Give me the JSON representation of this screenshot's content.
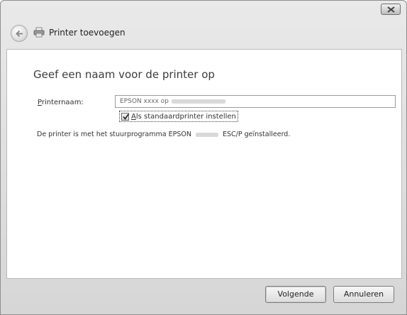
{
  "window": {
    "title": "Printer toevoegen"
  },
  "page": {
    "heading": "Geef een naam voor de printer op",
    "printer_name_label": "Printernaam:",
    "printer_name_value_prefix": "EPSON xxxx op",
    "default_checkbox_label": "Als standaardprinter instellen",
    "default_checkbox_checked": true,
    "info_prefix": "De printer is met het stuurprogramma EPSON",
    "info_suffix": "ESC/P geïnstalleerd."
  },
  "footer": {
    "next_label": "Volgende",
    "cancel_label": "Annuleren"
  },
  "icons": {
    "close": "close-icon",
    "back": "back-arrow-icon",
    "printer": "printer-icon",
    "check": "checkmark-icon"
  }
}
